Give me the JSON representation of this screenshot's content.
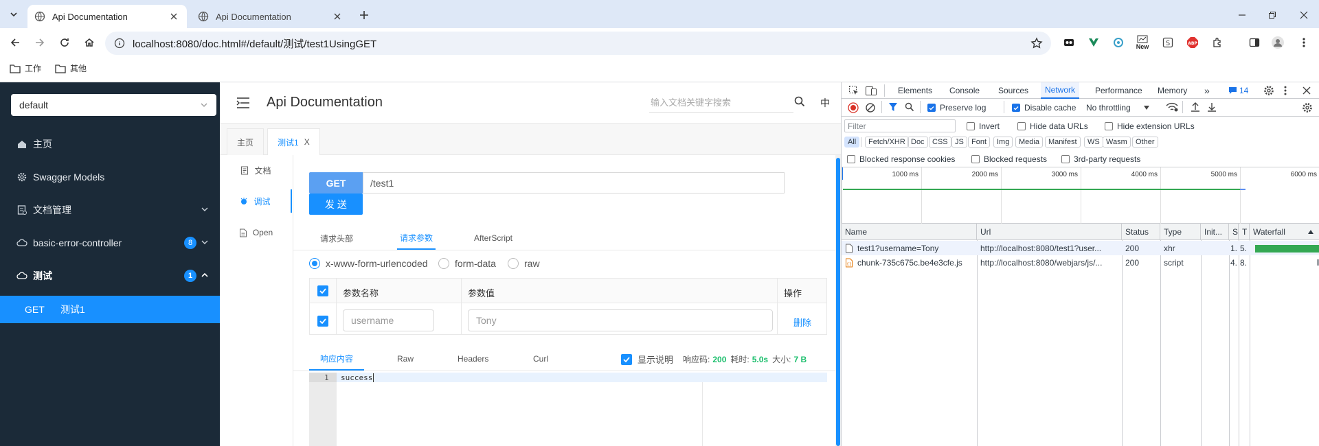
{
  "browser": {
    "tabs": [
      {
        "title": "Api Documentation",
        "active": true
      },
      {
        "title": "Api Documentation",
        "active": false
      }
    ],
    "url": "localhost:8080/doc.html#/default/测试/test1UsingGET",
    "bookmarks": [
      "工作",
      "其他"
    ],
    "extensions": {
      "new_label": "New",
      "abp_label": "ABP"
    }
  },
  "sidebar": {
    "group_select": "default",
    "items": [
      {
        "label": "主页",
        "icon": "home-icon"
      },
      {
        "label": "Swagger Models",
        "icon": "gear-icon"
      },
      {
        "label": "文档管理",
        "icon": "document-manage-icon"
      },
      {
        "label": "basic-error-controller",
        "icon": "cloud-icon",
        "badge": "8"
      },
      {
        "label": "测试",
        "icon": "cloud-icon",
        "badge": "1"
      }
    ],
    "sub_item": {
      "method": "GET",
      "label": "测试1"
    }
  },
  "main": {
    "title": "Api Documentation",
    "search_placeholder": "输入文档关键字搜索",
    "lang_label": "中",
    "doc_tabs": [
      {
        "label": "主页",
        "active": false
      },
      {
        "label": "测试1",
        "active": true,
        "close": "X"
      }
    ],
    "left_menu": [
      {
        "label": "文档",
        "icon": "document-icon",
        "active": false
      },
      {
        "label": "调试",
        "icon": "debug-icon",
        "active": true
      },
      {
        "label": "Open",
        "icon": "open-file-icon",
        "active": false
      }
    ],
    "method": "GET",
    "path": "/test1",
    "send_label": "发 送",
    "request_tabs": [
      {
        "label": "请求头部",
        "active": false
      },
      {
        "label": "请求参数",
        "active": true
      },
      {
        "label": "AfterScript",
        "active": false
      }
    ],
    "content_types": [
      {
        "label": "x-www-form-urlencoded",
        "checked": true
      },
      {
        "label": "form-data",
        "checked": false
      },
      {
        "label": "raw",
        "checked": false
      }
    ],
    "param_table": {
      "headers": [
        "参数名称",
        "参数值",
        "操作"
      ],
      "rows": [
        {
          "name": "username",
          "value": "Tony",
          "action": "删除"
        }
      ]
    },
    "response_tabs": [
      {
        "label": "响应内容",
        "active": true
      },
      {
        "label": "Raw",
        "active": false
      },
      {
        "label": "Headers",
        "active": false
      },
      {
        "label": "Curl",
        "active": false
      }
    ],
    "show_desc_label": "显示说明",
    "status_label": "响应码:",
    "status_value": "200",
    "time_label": "耗时:",
    "time_value": "5.0s",
    "size_label": "大小:",
    "size_value": "7 B",
    "response_body": {
      "line_no": "1",
      "text": "success"
    }
  },
  "devtools": {
    "tabs": [
      "Elements",
      "Console",
      "Sources",
      "Network",
      "Performance",
      "Memory"
    ],
    "active_tab": "Network",
    "more_label": "»",
    "issues_count": "14",
    "preserve_log": "Preserve log",
    "disable_cache": "Disable cache",
    "throttling": "No throttling",
    "filter_placeholder": "Filter",
    "invert": "Invert",
    "hide_data_urls": "Hide data URLs",
    "hide_ext_urls": "Hide extension URLs",
    "type_filters": [
      "All",
      "Fetch/XHR",
      "Doc",
      "CSS",
      "JS",
      "Font",
      "Img",
      "Media",
      "Manifest",
      "WS",
      "Wasm",
      "Other"
    ],
    "blocked_response_cookies": "Blocked response cookies",
    "blocked_requests": "Blocked requests",
    "third_party": "3rd-party requests",
    "timeline_ticks": [
      "1000 ms",
      "2000 ms",
      "3000 ms",
      "4000 ms",
      "5000 ms",
      "6000 ms"
    ],
    "columns": [
      "Name",
      "Url",
      "Status",
      "Type",
      "Init...",
      "S",
      "T",
      "Waterfall"
    ],
    "requests": [
      {
        "name": "test1?username=Tony",
        "url": "http://localhost:8080/test1?user...",
        "status": "200",
        "type": "xhr",
        "size": "1. 5.",
        "time": "5.",
        "icon": "xhr-file-icon"
      },
      {
        "name": "chunk-735c675c.be4e3cfe.js",
        "url": "http://localhost:8080/webjars/js/...",
        "status": "200",
        "type": "script",
        "size": "4.",
        "time": "8.",
        "icon": "script-file-icon"
      }
    ],
    "colors": {
      "accent": "#1a73e8",
      "record": "#d93025",
      "waterfall": "#34a853"
    }
  },
  "colors": {
    "brand": "#1890ff",
    "sidebar_bg": "#1b2a38",
    "get_method": "#5ba0f2",
    "success": "#19be6b"
  }
}
